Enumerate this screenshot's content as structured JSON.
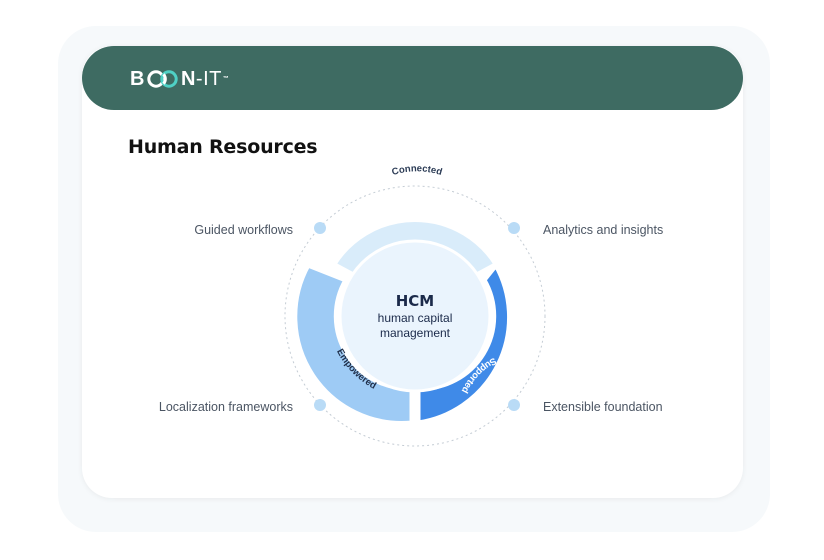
{
  "header": {
    "logo_left": "B",
    "logo_mid": "N",
    "logo_dash": "-",
    "logo_right": "IT",
    "logo_tm": "™"
  },
  "page": {
    "title": "Human Resources"
  },
  "diagram": {
    "center": {
      "title": "HCM",
      "line1": "human capital",
      "line2": "management"
    },
    "segments": {
      "top": "Connected",
      "left": "Empowered",
      "right": "Supported"
    },
    "features": {
      "top_left": "Guided workflows",
      "top_right": "Analytics and insights",
      "bottom_left": "Localization frameworks",
      "bottom_right": "Extensible foundation"
    },
    "colors": {
      "header": "#3e6b62",
      "segment_top": "#d9ecfa",
      "segment_left": "#9ecbf5",
      "segment_right": "#3f8ae8",
      "center": "#eaf4fd",
      "dot": "#b9dbf6"
    }
  }
}
